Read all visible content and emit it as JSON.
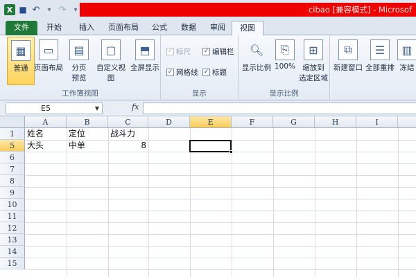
{
  "titlebar": {
    "title": "cibao [兼容模式] - Microsof"
  },
  "tabs": [
    {
      "label": "文件"
    },
    {
      "label": "开始"
    },
    {
      "label": "插入"
    },
    {
      "label": "页面布局"
    },
    {
      "label": "公式"
    },
    {
      "label": "数据"
    },
    {
      "label": "审阅"
    },
    {
      "label": "视图"
    }
  ],
  "ribbon": {
    "workbook_views": {
      "label": "工作簿视图",
      "normal": "普通",
      "page_layout": "页面布局",
      "page_break_1": "分页",
      "page_break_2": "预览",
      "custom_views": "自定义视图",
      "full_screen": "全屏显示"
    },
    "show": {
      "label": "显示",
      "ruler": "标尺",
      "formula_bar": "编辑栏",
      "gridlines": "网格线",
      "headings": "标题"
    },
    "zoom": {
      "label": "显示比例",
      "zoom": "显示比例",
      "hundred": "100%",
      "zoom_sel_1": "缩放到",
      "zoom_sel_2": "选定区域"
    },
    "window": {
      "new_window": "新建窗口",
      "arrange_all": "全部重排",
      "freeze": "冻结"
    }
  },
  "formula_bar": {
    "name_box": "E5",
    "fx": "fx",
    "content": ""
  },
  "sheet": {
    "columns": [
      "A",
      "B",
      "C",
      "D",
      "E",
      "F",
      "G",
      "H",
      "I"
    ],
    "rows": [
      "1",
      "5",
      "6",
      "7",
      "8",
      "9",
      "10",
      "11",
      "12",
      "13",
      "14",
      "15"
    ],
    "header_row": [
      "姓名",
      "定位",
      "战斗力"
    ],
    "data_row": [
      "大头",
      "中单",
      "8"
    ],
    "active_cell": "E5"
  },
  "colors": {
    "file_tab": "#1f7a3a",
    "title_redaction": "#ee0000",
    "selection_header": "#f8cc5a"
  }
}
